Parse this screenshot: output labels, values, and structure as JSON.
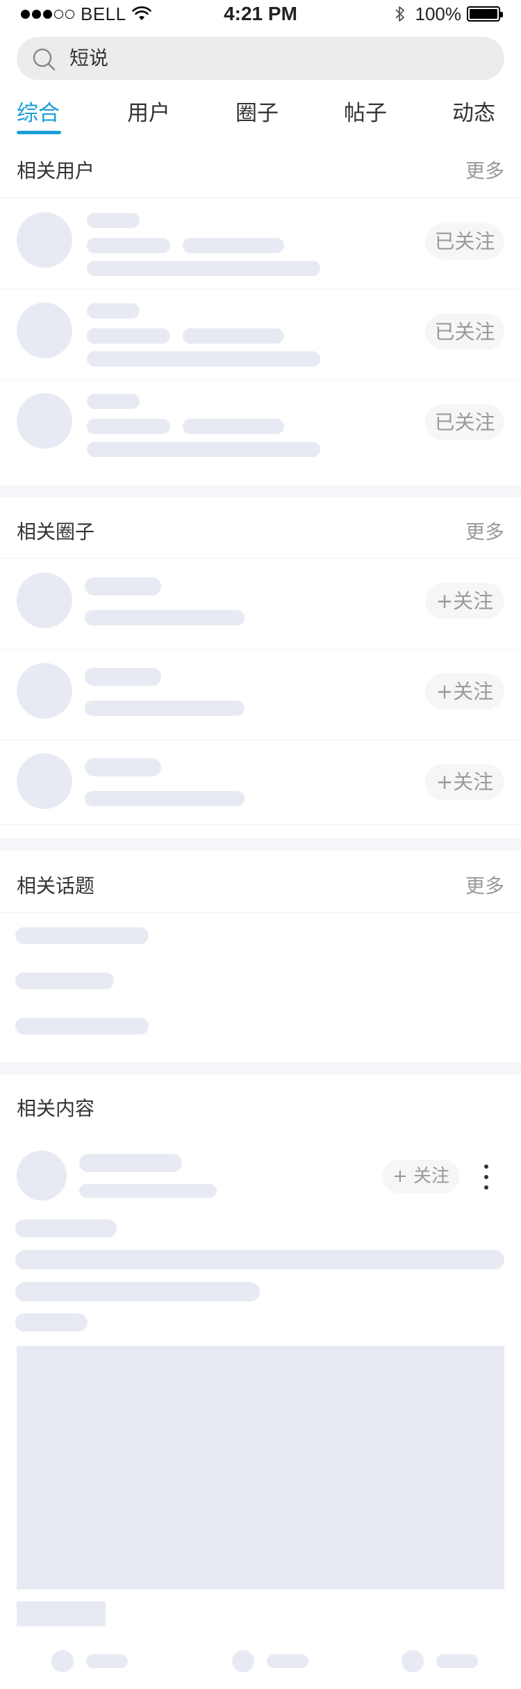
{
  "status_bar": {
    "carrier": "BELL",
    "time": "4:21 PM",
    "battery": "100%",
    "signal_icon": "signal-dots-icon",
    "wifi_icon": "wifi-icon",
    "bluetooth_icon": "bluetooth-icon",
    "battery_level": 1.0
  },
  "search": {
    "value": "短说",
    "icon": "search-icon"
  },
  "tabs": [
    {
      "label": "综合",
      "active": true
    },
    {
      "label": "用户",
      "active": false
    },
    {
      "label": "圈子",
      "active": false
    },
    {
      "label": "帖子",
      "active": false
    },
    {
      "label": "动态",
      "active": false
    }
  ],
  "sections": {
    "users": {
      "title": "相关用户",
      "more": "更多",
      "rows": [
        {
          "action": "已关注"
        },
        {
          "action": "已关注"
        },
        {
          "action": "已关注"
        }
      ]
    },
    "circles": {
      "title": "相关圈子",
      "more": "更多",
      "rows": [
        {
          "action": "+关注"
        },
        {
          "action": "+关注"
        },
        {
          "action": "+关注"
        }
      ]
    },
    "topics": {
      "title": "相关话题",
      "more": "更多"
    },
    "content": {
      "title": "相关内容",
      "follow": "+ 关注",
      "menu_icon": "more-vertical-icon"
    }
  },
  "colors": {
    "accent": "#1b9ed8",
    "skeleton": "#e8eaf3",
    "section_gap": "#f5f6f9",
    "muted_text": "#999999"
  }
}
